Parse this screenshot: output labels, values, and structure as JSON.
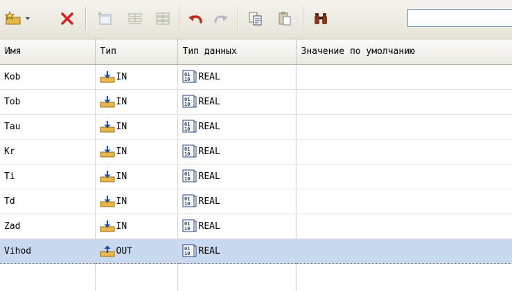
{
  "toolbar": {
    "search_value": "",
    "buttons": [
      "add-menu",
      "delete",
      "window",
      "grid-a",
      "grid-b",
      "undo",
      "redo",
      "copy",
      "paste",
      "find"
    ]
  },
  "table": {
    "columns": [
      "Имя",
      "Тип",
      "Тип данных",
      "Значение по умолчанию"
    ],
    "rows": [
      {
        "name": "Kob",
        "type": "IN",
        "data_type": "REAL",
        "default": ""
      },
      {
        "name": "Tob",
        "type": "IN",
        "data_type": "REAL",
        "default": ""
      },
      {
        "name": "Tau",
        "type": "IN",
        "data_type": "REAL",
        "default": ""
      },
      {
        "name": "Kr",
        "type": "IN",
        "data_type": "REAL",
        "default": ""
      },
      {
        "name": "Ti",
        "type": "IN",
        "data_type": "REAL",
        "default": ""
      },
      {
        "name": "Td",
        "type": "IN",
        "data_type": "REAL",
        "default": ""
      },
      {
        "name": "Zad",
        "type": "IN",
        "data_type": "REAL",
        "default": ""
      },
      {
        "name": "Vihod",
        "type": "OUT",
        "data_type": "REAL",
        "default": ""
      }
    ],
    "selected_row": 7
  },
  "colors": {
    "selection": "#c9d9ef",
    "delete_red": "#d81e1e",
    "undo_red": "#c0281e"
  }
}
